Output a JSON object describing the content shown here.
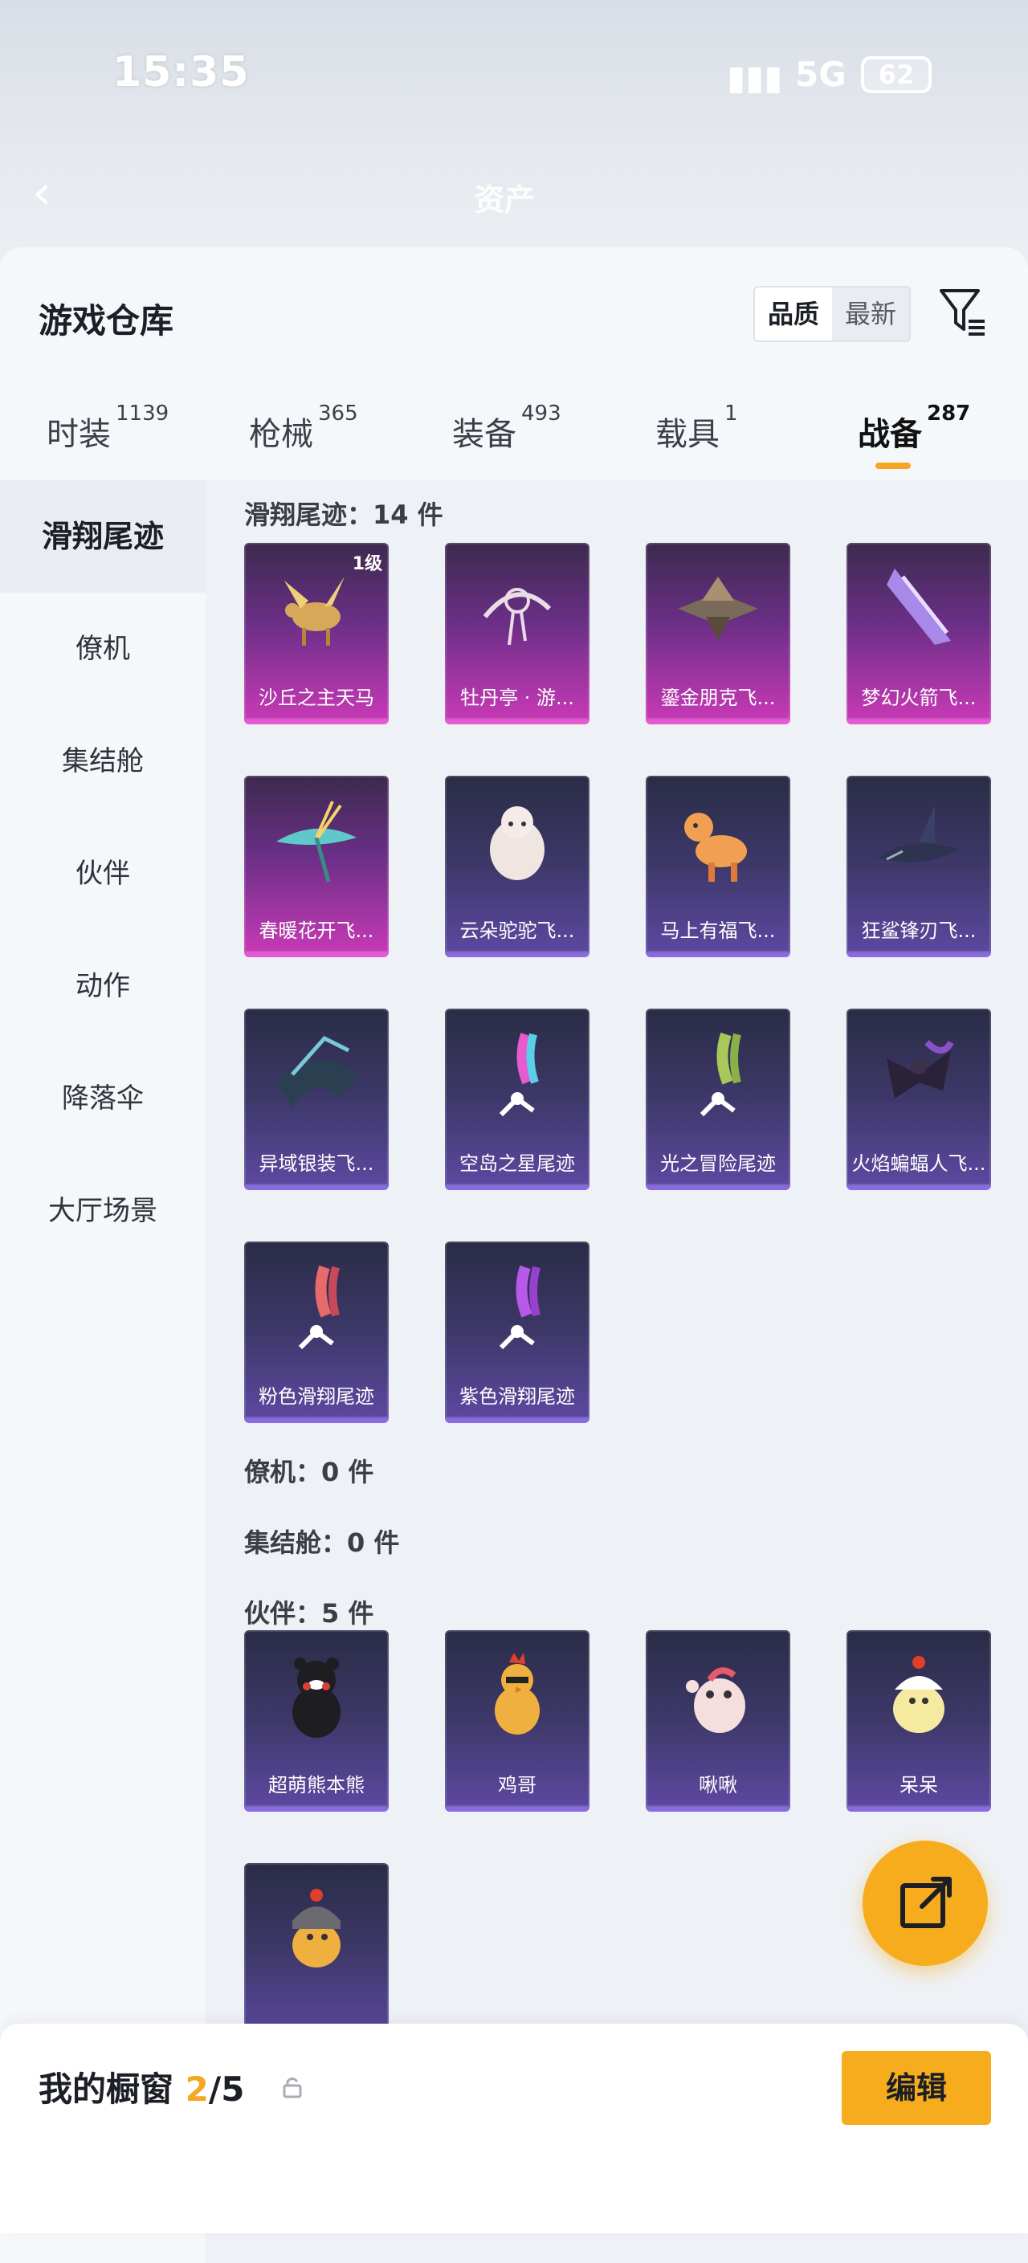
{
  "status_bar": {
    "time": "15:35",
    "network": "5G",
    "battery": "62"
  },
  "nav": {
    "title": "资产"
  },
  "header": {
    "title": "游戏仓库",
    "sort_options": [
      "品质",
      "最新"
    ],
    "sort_selected": "品质"
  },
  "tabs": [
    {
      "label": "时装",
      "count": "1139"
    },
    {
      "label": "枪械",
      "count": "365"
    },
    {
      "label": "装备",
      "count": "493"
    },
    {
      "label": "载具",
      "count": "1"
    },
    {
      "label": "战备",
      "count": "287",
      "active": true
    }
  ],
  "sidebar": {
    "items": [
      {
        "label": "滑翔尾迹",
        "active": true
      },
      {
        "label": "僚机"
      },
      {
        "label": "集结舱"
      },
      {
        "label": "伙伴"
      },
      {
        "label": "动作"
      },
      {
        "label": "降落伞"
      },
      {
        "label": "大厅场景"
      }
    ]
  },
  "sections": {
    "glide": {
      "header": "滑翔尾迹：14 件",
      "items": [
        {
          "name": "沙丘之主天马",
          "badge": "1级",
          "rarity": "purple"
        },
        {
          "name": "牡丹亭 · 游...",
          "rarity": "purple"
        },
        {
          "name": "鎏金朋克飞...",
          "rarity": "purple"
        },
        {
          "name": "梦幻火箭飞...",
          "rarity": "purple"
        },
        {
          "name": "春暖花开飞...",
          "rarity": "purple"
        },
        {
          "name": "云朵驼驼飞...",
          "rarity": "blue"
        },
        {
          "name": "马上有福飞...",
          "rarity": "blue"
        },
        {
          "name": "狂鲨锋刃飞...",
          "rarity": "blue"
        },
        {
          "name": "异域银装飞...",
          "rarity": "blue"
        },
        {
          "name": "空岛之星尾迹",
          "rarity": "blue"
        },
        {
          "name": "光之冒险尾迹",
          "rarity": "blue"
        },
        {
          "name": "火焰蝙蝠人飞...",
          "rarity": "blue"
        },
        {
          "name": "粉色滑翔尾迹",
          "rarity": "blue"
        },
        {
          "name": "紫色滑翔尾迹",
          "rarity": "blue"
        }
      ]
    },
    "wingman": {
      "header": "僚机：0 件"
    },
    "pod": {
      "header": "集结舱：0 件"
    },
    "partner": {
      "header": "伙伴：5 件",
      "items": [
        {
          "name": "超萌熊本熊",
          "rarity": "blue"
        },
        {
          "name": "鸡哥",
          "rarity": "blue"
        },
        {
          "name": "啾啾",
          "rarity": "blue"
        },
        {
          "name": "呆呆",
          "rarity": "blue"
        },
        {
          "name": "",
          "rarity": "blue"
        }
      ]
    }
  },
  "showcase": {
    "title_prefix": "我的橱窗 ",
    "count": "2",
    "total": "/5",
    "edit_label": "编辑"
  },
  "colors": {
    "accent": "#f6ac1d",
    "purple_card": "#c639b5",
    "blue_card": "#5c48a0"
  }
}
